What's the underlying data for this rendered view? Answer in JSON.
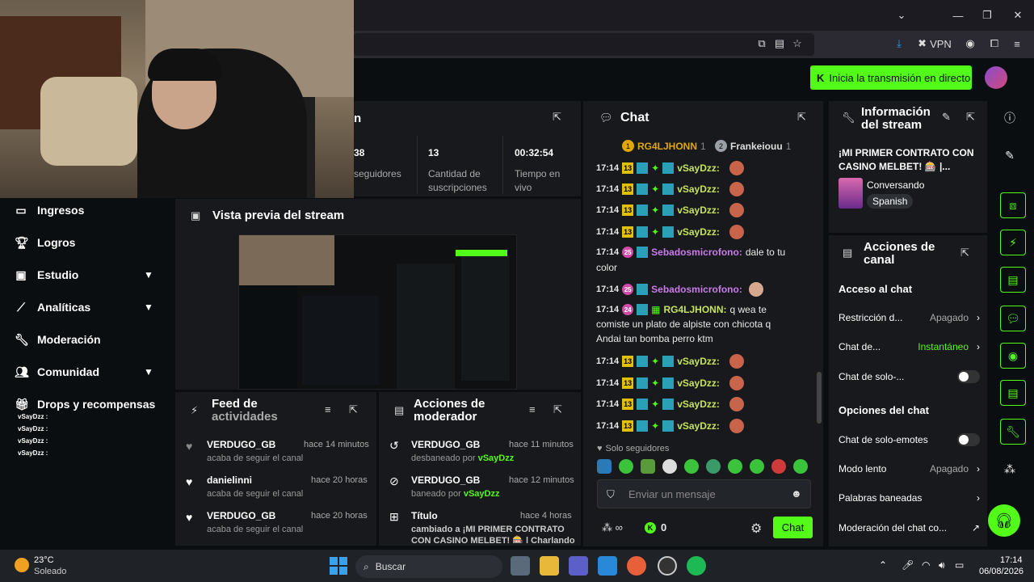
{
  "browser": {
    "vpn_label": "VPN"
  },
  "header": {
    "go_live_label": "Inicia la transmisión en directo"
  },
  "sidebar": {
    "items": [
      {
        "label": "Ingresos"
      },
      {
        "label": "Logros"
      },
      {
        "label": "Estudio"
      },
      {
        "label": "Analíticas"
      },
      {
        "label": "Moderación"
      },
      {
        "label": "Comunidad"
      },
      {
        "label": "Drops y recompensas"
      }
    ],
    "mini_chat": [
      "vSayDzz :",
      "vSayDzz :",
      "vSayDzz :",
      "vSayDzz :"
    ]
  },
  "stats": {
    "partial_title": "n",
    "followers_value": "38",
    "followers_label": "seguidores",
    "subs_value": "13",
    "subs_label_1": "Cantidad de",
    "subs_label_2": "suscripciones",
    "time_value": "00:32:54",
    "time_label_1": "Tiempo en",
    "time_label_2": "vivo"
  },
  "preview": {
    "title": "Vista previa del stream"
  },
  "activity_feed": {
    "title_1": "Feed de",
    "title_2": "actividades",
    "items": [
      {
        "name": "VERDUGO_GB",
        "time": "hace 14 minutos",
        "sub": "acaba de seguir el canal"
      },
      {
        "name": "danielinni",
        "time": "hace 20 horas",
        "sub": "acaba de seguir el canal"
      },
      {
        "name": "VERDUGO_GB",
        "time": "hace 20 horas",
        "sub": "acaba de seguir el canal"
      }
    ]
  },
  "mod_actions": {
    "title_1": "Acciones de",
    "title_2": "moderador",
    "items": [
      {
        "name": "VERDUGO_GB",
        "time": "hace 11 minutos",
        "sub": "desbaneado por",
        "by": "vSayDzz"
      },
      {
        "name": "VERDUGO_GB",
        "time": "hace 12 minutos",
        "sub": "baneado por",
        "by": "vSayDzz"
      },
      {
        "name": "Título",
        "time": "hace 4 horas",
        "sub": "cambiado a ¡MI PRIMER CONTRATO",
        "sub2": "CON CASINO MELBET! 🎰 | Charlando"
      }
    ]
  },
  "chat": {
    "title": "Chat",
    "top_gifters": [
      {
        "rank": "1",
        "name": "RG4LJHONN",
        "count": "1"
      },
      {
        "rank": "2",
        "name": "Frankeiouu",
        "count": "1"
      }
    ],
    "messages": [
      {
        "time": "17:14",
        "badge": "13",
        "user": "vSayDzz:"
      },
      {
        "time": "17:14",
        "badge": "13",
        "user": "vSayDzz:"
      },
      {
        "time": "17:14",
        "badge": "13",
        "user": "vSayDzz:"
      },
      {
        "time": "17:14",
        "badge": "13",
        "user": "vSayDzz:"
      },
      {
        "time": "17:14",
        "badge": "25",
        "user": "Sebadosmicrofono:",
        "text": "dale to tu",
        "text2": "color"
      },
      {
        "time": "17:14",
        "badge": "25",
        "user": "Sebadosmicrofono:"
      },
      {
        "time": "17:14",
        "badge": "24",
        "user": "RG4LJHONN:",
        "text": "q wea te",
        "text2": "comiste un plato de alpiste con chicota q",
        "text3": "Andai tan bomba perro ktm"
      },
      {
        "time": "17:14",
        "badge": "13",
        "user": "vSayDzz:"
      },
      {
        "time": "17:14",
        "badge": "13",
        "user": "vSayDzz:"
      },
      {
        "time": "17:14",
        "badge": "13",
        "user": "vSayDzz:"
      },
      {
        "time": "17:14",
        "badge": "13",
        "user": "vSayDzz:"
      }
    ],
    "followers_only": "Solo seguidores",
    "input_placeholder": "Enviar un mensaje",
    "points": "0",
    "send_label": "Chat"
  },
  "stream_info": {
    "title_1": "Información",
    "title_2": "del stream",
    "stream_title_1": "¡MI PRIMER CONTRATO CON",
    "stream_title_2": "CASINO MELBET! 🎰 |...",
    "category": "Conversando",
    "language": "Spanish"
  },
  "channel_actions": {
    "title_1": "Acciones de",
    "title_2": "canal",
    "chat_access": "Acceso al chat",
    "restriction_label": "Restricción d...",
    "restriction_value": "Apagado",
    "chat_de_label": "Chat de...",
    "chat_de_value": "Instantáneo",
    "solo_label": "Chat de solo-...",
    "chat_options": "Opciones del chat",
    "emotes_label": "Chat de solo-emotes",
    "slow_label": "Modo lento",
    "slow_value": "Apagado",
    "banned_words": "Palabras baneadas",
    "moderation_label": "Moderación del chat co..."
  },
  "taskbar": {
    "weather_temp": "23°C",
    "weather_desc": "Soleado",
    "search_label": "Buscar",
    "time": "17:14",
    "date": "06/08/2026"
  },
  "colors": {
    "accent": "#53fc18",
    "panel": "#17191c",
    "bg": "#0b0e10"
  }
}
